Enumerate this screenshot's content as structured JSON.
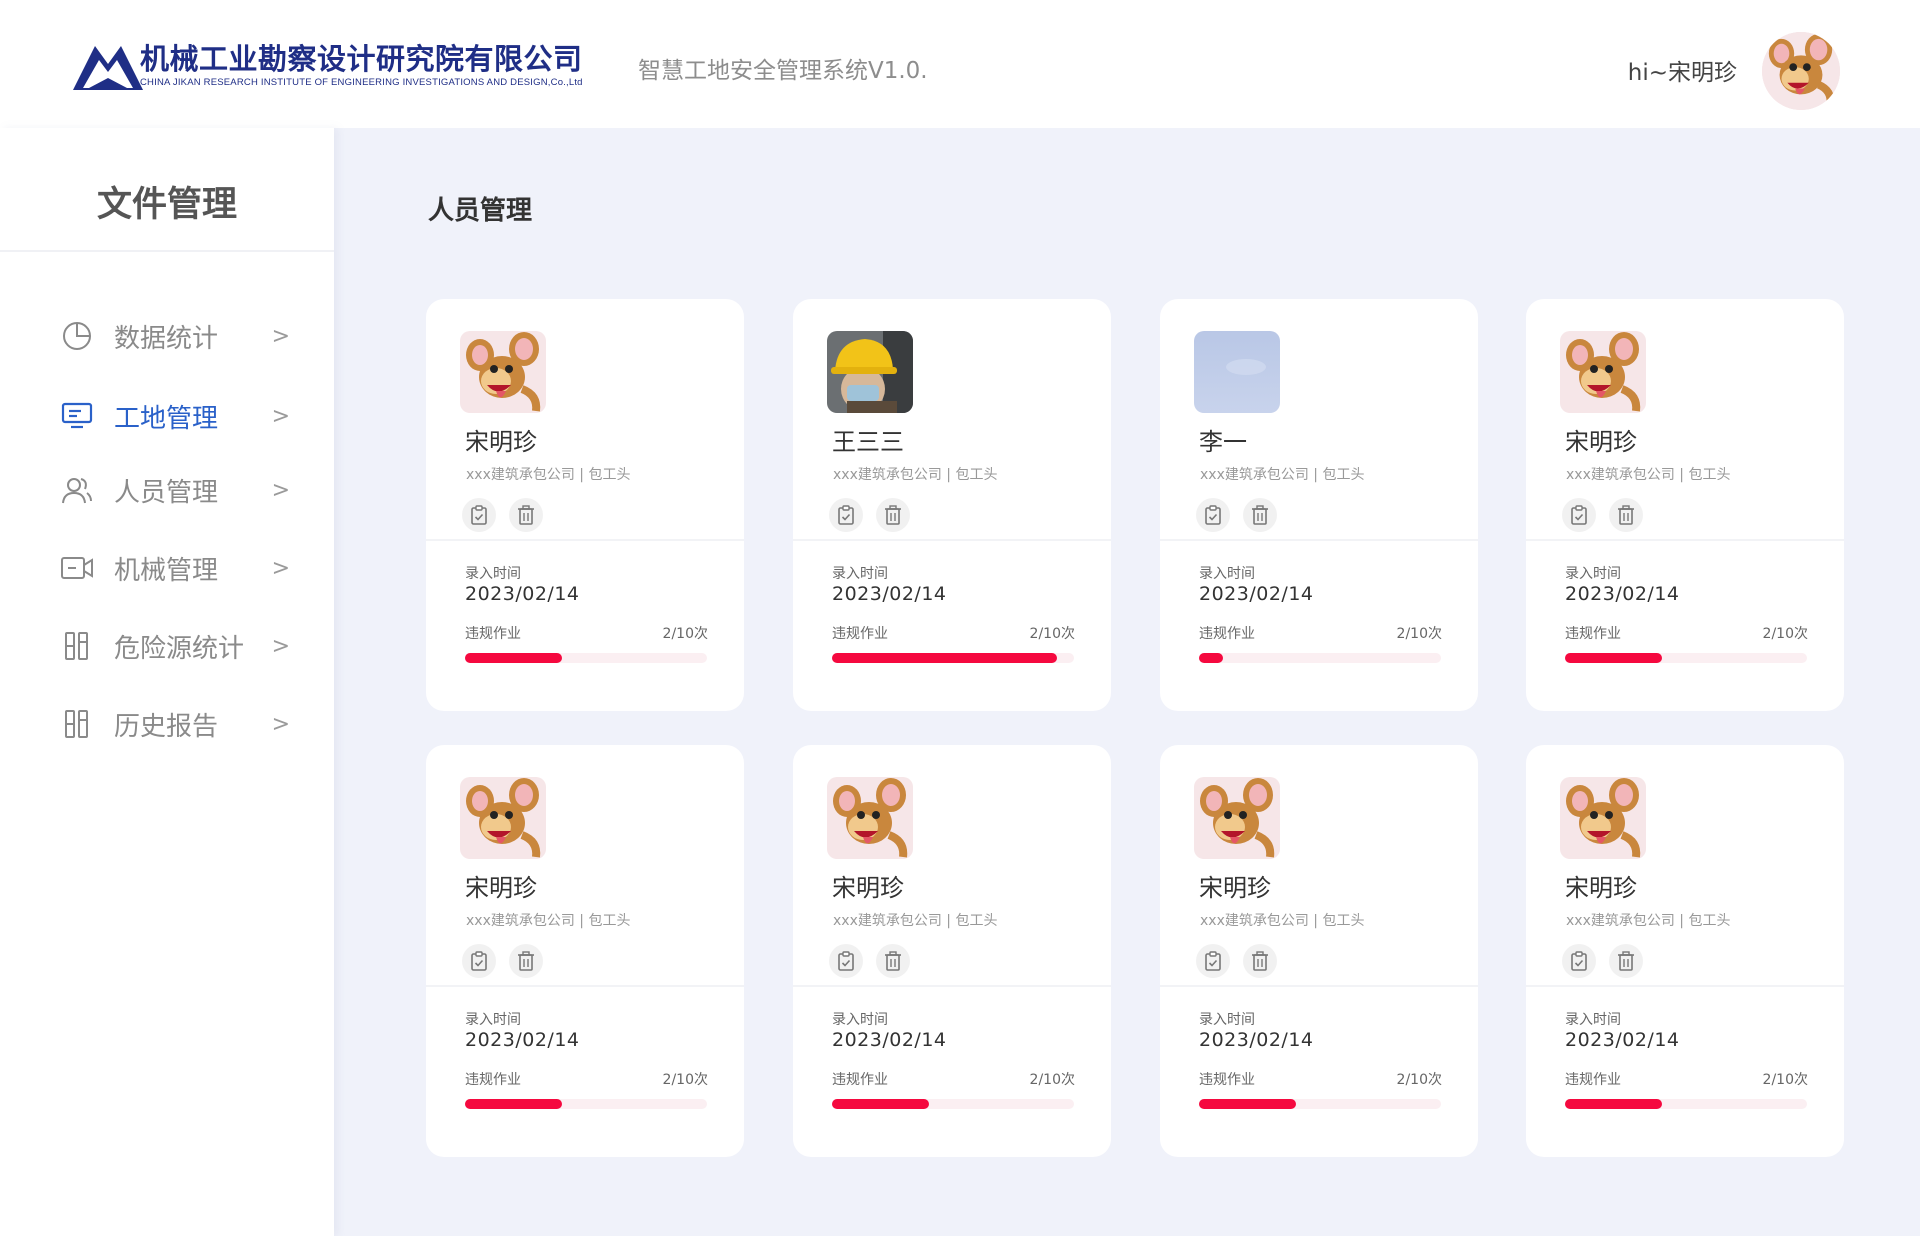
{
  "header": {
    "company_cn": "机械工业勘察设计研究院有限公司",
    "company_en": "CHINA JIKAN RESEARCH INSTITUTE OF ENGINEERING INVESTIGATIONS AND DESIGN,Co.,Ltd",
    "system_name": "智慧工地安全管理系统V1.0.",
    "greeting": "hi~宋明珍",
    "brand_color": "#1f2e86"
  },
  "sidebar": {
    "title": "文件管理",
    "items": [
      {
        "label": "数据统计",
        "icon": "pie-chart-icon",
        "active": false
      },
      {
        "label": "工地管理",
        "icon": "monitor-icon",
        "active": true
      },
      {
        "label": "人员管理",
        "icon": "people-icon",
        "active": false
      },
      {
        "label": "机械管理",
        "icon": "video-camera-icon",
        "active": false
      },
      {
        "label": "危险源统计",
        "icon": "columns-icon",
        "active": false
      },
      {
        "label": "历史报告",
        "icon": "columns-icon",
        "active": false
      }
    ],
    "chevron": ">",
    "active_color": "#2a61c9"
  },
  "main": {
    "title": "人员管理",
    "cards": [
      {
        "name": "宋明珍",
        "company": "xxx建筑承包公司 | 包工头",
        "date_label": "录入时间",
        "date": "2023/02/14",
        "violation_label": "违规作业",
        "violation_count": "2/10次",
        "progress": 0.4,
        "avatar": "cartoon-mouse"
      },
      {
        "name": "王三三",
        "company": "xxx建筑承包公司 | 包工头",
        "date_label": "录入时间",
        "date": "2023/02/14",
        "violation_label": "违规作业",
        "violation_count": "2/10次",
        "progress": 0.93,
        "avatar": "worker-helmet"
      },
      {
        "name": "李一",
        "company": "xxx建筑承包公司 | 包工头",
        "date_label": "录入时间",
        "date": "2023/02/14",
        "violation_label": "违规作业",
        "violation_count": "2/10次",
        "progress": 0.1,
        "avatar": "blue-sky"
      },
      {
        "name": "宋明珍",
        "company": "xxx建筑承包公司 | 包工头",
        "date_label": "录入时间",
        "date": "2023/02/14",
        "violation_label": "违规作业",
        "violation_count": "2/10次",
        "progress": 0.4,
        "avatar": "cartoon-mouse"
      },
      {
        "name": "宋明珍",
        "company": "xxx建筑承包公司 | 包工头",
        "date_label": "录入时间",
        "date": "2023/02/14",
        "violation_label": "违规作业",
        "violation_count": "2/10次",
        "progress": 0.4,
        "avatar": "cartoon-mouse"
      },
      {
        "name": "宋明珍",
        "company": "xxx建筑承包公司 | 包工头",
        "date_label": "录入时间",
        "date": "2023/02/14",
        "violation_label": "违规作业",
        "violation_count": "2/10次",
        "progress": 0.4,
        "avatar": "cartoon-mouse"
      },
      {
        "name": "宋明珍",
        "company": "xxx建筑承包公司 | 包工头",
        "date_label": "录入时间",
        "date": "2023/02/14",
        "violation_label": "违规作业",
        "violation_count": "2/10次",
        "progress": 0.4,
        "avatar": "cartoon-mouse"
      },
      {
        "name": "宋明珍",
        "company": "xxx建筑承包公司 | 包工头",
        "date_label": "录入时间",
        "date": "2023/02/14",
        "violation_label": "违规作业",
        "violation_count": "2/10次",
        "progress": 0.4,
        "avatar": "cartoon-mouse"
      }
    ],
    "progress_color": "#f5093f",
    "background": "#f0f2fa"
  }
}
